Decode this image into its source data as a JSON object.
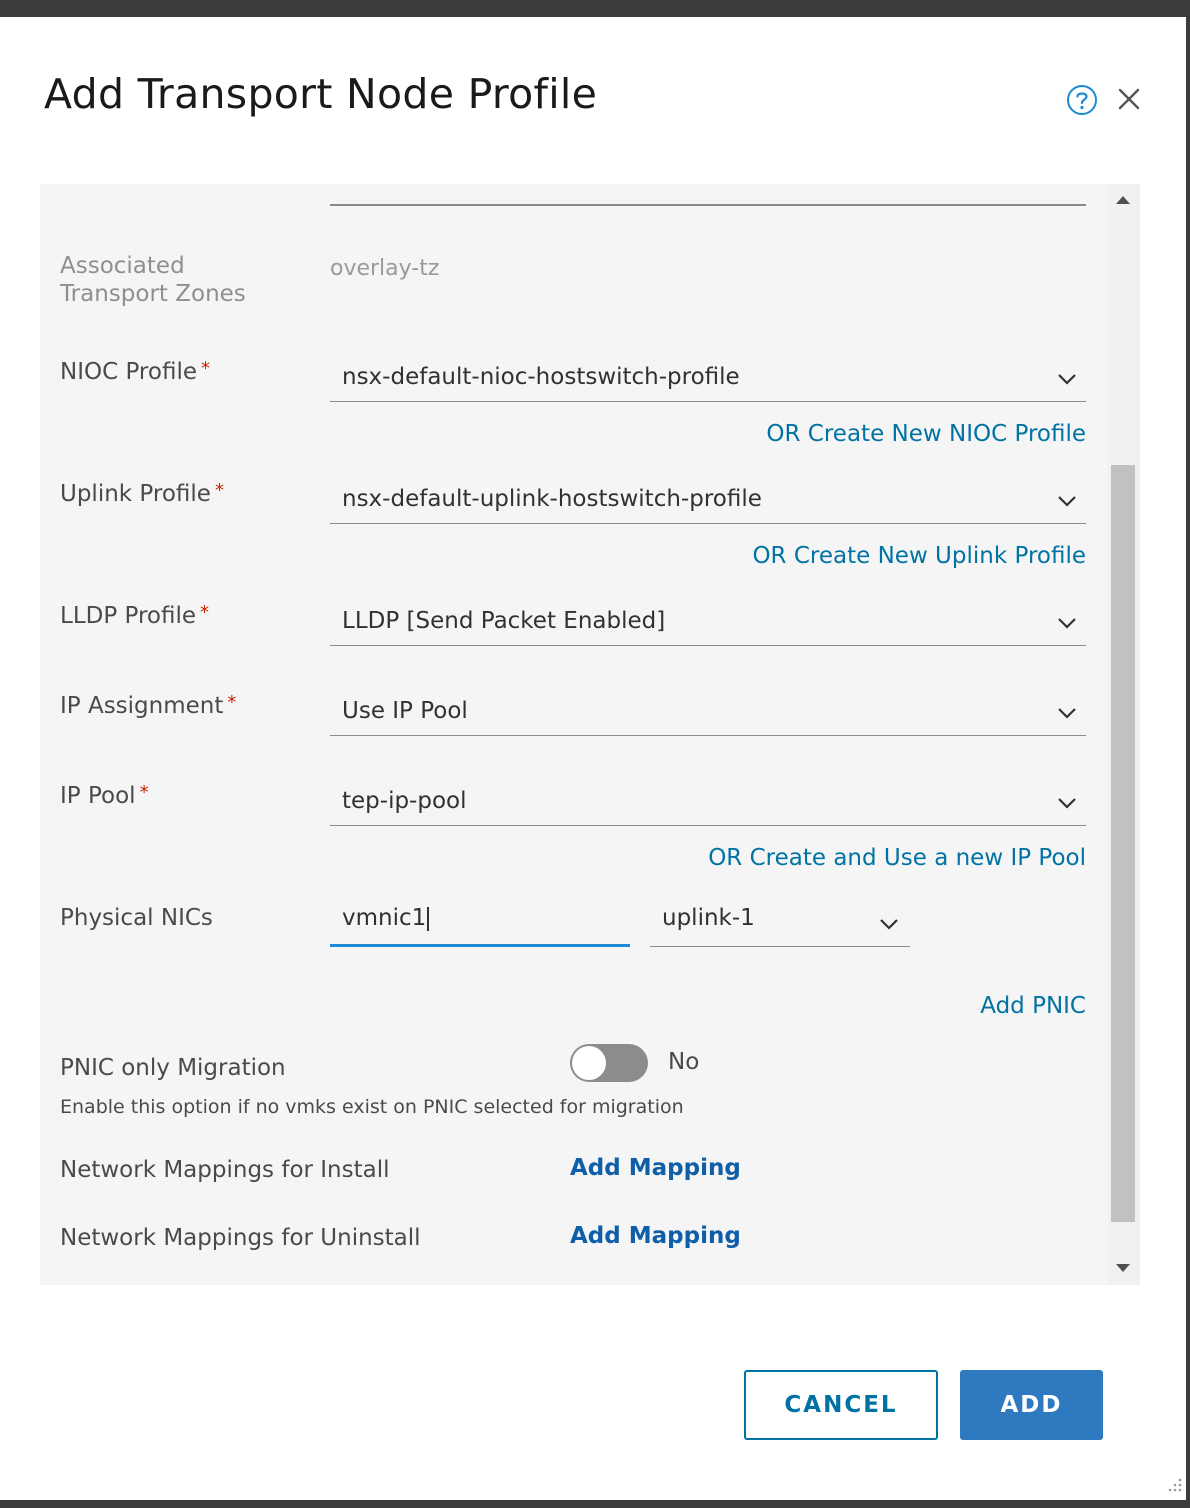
{
  "dialog": {
    "title": "Add Transport Node Profile"
  },
  "form": {
    "assoc_tz_label_line1": "Associated",
    "assoc_tz_label_line2": "Transport Zones",
    "assoc_tz_value": "overlay-tz",
    "nioc": {
      "label": "NIOC Profile",
      "value": "nsx-default-nioc-hostswitch-profile",
      "link": "OR Create New NIOC Profile"
    },
    "uplink": {
      "label": "Uplink Profile",
      "value": "nsx-default-uplink-hostswitch-profile",
      "link": "OR Create New Uplink Profile"
    },
    "lldp": {
      "label": "LLDP Profile",
      "value": "LLDP [Send Packet Enabled]"
    },
    "ip_assignment": {
      "label": "IP Assignment",
      "value": "Use IP Pool"
    },
    "ip_pool": {
      "label": "IP Pool",
      "value": "tep-ip-pool",
      "link": "OR Create and Use a new IP Pool"
    },
    "physical_nics": {
      "label": "Physical NICs",
      "nic_value": "vmnic1",
      "uplink_value": "uplink-1",
      "add_link": "Add PNIC"
    },
    "pnic_migration": {
      "label": "PNIC only Migration",
      "toggle_text": "No",
      "toggle_on": false,
      "hint": "Enable this option if no vmks exist on PNIC selected for migration"
    },
    "mapping_install": {
      "label": "Network Mappings for Install",
      "link": "Add Mapping"
    },
    "mapping_uninstall": {
      "label": "Network Mappings for Uninstall",
      "link": "Add Mapping"
    },
    "required_mark": "*"
  },
  "footer": {
    "cancel_label": "CANCEL",
    "add_label": "ADD"
  },
  "colors": {
    "link": "#0072a3",
    "primary_button": "#2f79c0",
    "required": "#c92100",
    "focus_underline": "#1b8bd6"
  }
}
